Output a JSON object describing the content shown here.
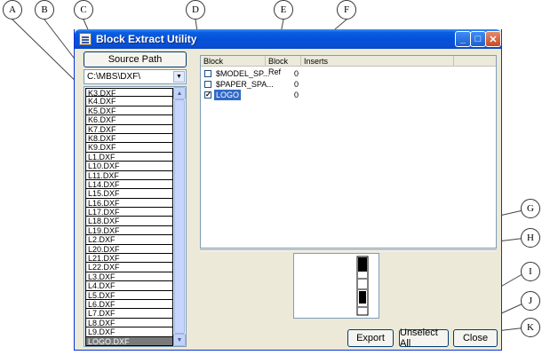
{
  "window": {
    "title": "Block Extract Utility"
  },
  "title_buttons": {
    "minimize": "_",
    "maximize": "□",
    "close": "✕"
  },
  "source_path_button": "Source Path",
  "path_combo": {
    "value": "C:\\MBS\\DXF\\"
  },
  "file_list": [
    "K3.DXF",
    "K4.DXF",
    "K5.DXF",
    "K6.DXF",
    "K7.DXF",
    "K8.DXF",
    "K9.DXF",
    "L1.DXF",
    "L10.DXF",
    "L11.DXF",
    "L14.DXF",
    "L15.DXF",
    "L16.DXF",
    "L17.DXF",
    "L18.DXF",
    "L19.DXF",
    "L2.DXF",
    "L20.DXF",
    "L21.DXF",
    "L22.DXF",
    "L3.DXF",
    "L4.DXF",
    "L5.DXF",
    "L6.DXF",
    "L7.DXF",
    "L8.DXF",
    "L9.DXF",
    "LOGO.DXF"
  ],
  "file_list_selected": "LOGO.DXF",
  "block_table": {
    "headers": {
      "block": "Block",
      "block_ref": "Block Ref",
      "inserts": "Inserts"
    },
    "rows": [
      {
        "name": "$MODEL_SP...",
        "ref": "0",
        "checked": false,
        "selected": false
      },
      {
        "name": "$PAPER_SPA...",
        "ref": "0",
        "checked": false,
        "selected": false
      },
      {
        "name": "LOGO",
        "ref": "0",
        "checked": true,
        "selected": true
      }
    ]
  },
  "buttons": {
    "export": "Export",
    "unselect_all": "Unselect All",
    "close": "Close"
  },
  "callouts": [
    "A",
    "B",
    "C",
    "D",
    "E",
    "F",
    "G",
    "H",
    "I",
    "J",
    "K"
  ],
  "colors": {
    "title_bar": "#0a5fe2",
    "selection": "#316ac5",
    "window_bg": "#ece9d8"
  }
}
